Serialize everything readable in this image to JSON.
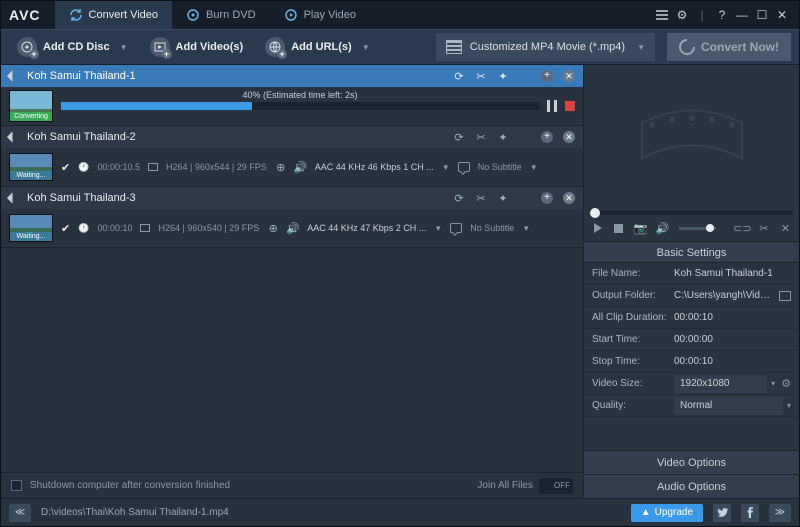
{
  "app": {
    "logo": "AVC"
  },
  "tabs": {
    "convert": "Convert Video",
    "burn": "Burn DVD",
    "play": "Play Video"
  },
  "toolbar": {
    "add_cd": "Add CD Disc",
    "add_videos": "Add Video(s)",
    "add_urls": "Add URL(s)",
    "profile": "Customized MP4 Movie (*.mp4)",
    "convert_now": "Convert Now!"
  },
  "files": [
    {
      "title": "Koh Samui Thailand-1",
      "status": "Converting",
      "progress_pct": 40,
      "progress_text": "40% (Estimated time left: 2s)"
    },
    {
      "title": "Koh Samui Thailand-2",
      "status": "Waiting...",
      "duration": "00:00:10.5",
      "video": "H264 | 960x544 | 29 FPS",
      "audio": "AAC 44 KHz 46 Kbps 1 CH ...",
      "subtitle": "No Subtitle"
    },
    {
      "title": "Koh Samui Thailand-3",
      "status": "Waiting...",
      "duration": "00:00:10",
      "video": "H264 | 960x540 | 29 FPS",
      "audio": "AAC 44 KHz 47 Kbps 2 CH ...",
      "subtitle": "No Subtitle"
    }
  ],
  "bottom": {
    "shutdown": "Shutdown computer after conversion finished",
    "join": "Join All Files",
    "toggle": "OFF"
  },
  "settings": {
    "header": "Basic Settings",
    "file_name_l": "File Name:",
    "file_name_v": "Koh Samui Thailand-1",
    "output_l": "Output Folder:",
    "output_v": "C:\\Users\\yangh\\Videos...",
    "clip_l": "All Clip Duration:",
    "clip_v": "00:00:10",
    "start_l": "Start Time:",
    "start_v": "00:00:00",
    "stop_l": "Stop Time:",
    "stop_v": "00:00:10",
    "size_l": "Video Size:",
    "size_v": "1920x1080",
    "quality_l": "Quality:",
    "quality_v": "Normal",
    "video_opt": "Video Options",
    "audio_opt": "Audio Options"
  },
  "status": {
    "path": "D:\\videos\\Thai\\Koh Samui Thailand-1.mp4",
    "upgrade": "Upgrade"
  }
}
